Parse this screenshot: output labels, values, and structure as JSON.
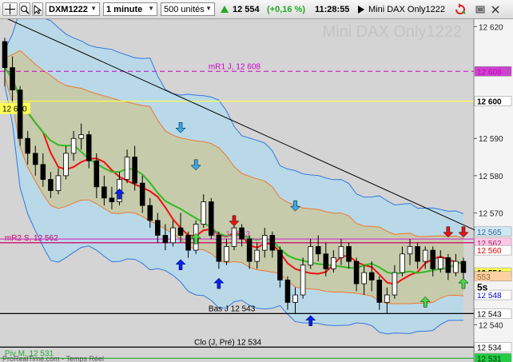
{
  "toolbar": {
    "instrument": "DXM1222",
    "timeframe": "1 minute",
    "units": "500 unités",
    "price": "12 554",
    "change": "(+0,16 %)",
    "time": "11:28:55",
    "name": "Mini DAX Only1222"
  },
  "chart": {
    "watermark": "Mini DAX Only1222",
    "countdown": "5s",
    "footer": "ProRealTime.com - Temps Réel",
    "colors": {
      "up": "#33ff66",
      "down": "#ee2211",
      "bg": "#d4d4d4",
      "accent": "#2a6ad4"
    },
    "price_axis": {
      "range": [
        12530,
        12622
      ],
      "ticks": [
        12620,
        12590,
        12580,
        12570,
        12540
      ]
    },
    "axis_labels": [
      {
        "price": 12608,
        "text": "12 608",
        "color": "#cc44cc",
        "text_color": "#cc00cc"
      },
      {
        "price": 12600,
        "text": "12 600",
        "color": "#ffffff",
        "text_color": "#000000",
        "bold": true
      },
      {
        "price": 12565,
        "text": "12 565",
        "color": "#cfe8f8",
        "text_color": "#336688"
      },
      {
        "price": 12562,
        "text": "12 562",
        "color": "#ffc8e8",
        "text_color": "#aa2266"
      },
      {
        "price": 12560,
        "text": "12 560",
        "color": "#ffffff",
        "text_color": "#dd0000"
      },
      {
        "price": 12554,
        "text": "12 554",
        "color": "#ffff55",
        "text_color": "#000000",
        "bold": true
      },
      {
        "price": 12553,
        "text": "553",
        "color": "#ffd0a0",
        "text_color": "#996633"
      },
      {
        "price": 12548,
        "text": "12 548",
        "color": "#ffffff",
        "text_color": "#0000cc"
      },
      {
        "price": 12543,
        "text": "12 543",
        "color": "#ffffff",
        "text_color": "#000000"
      },
      {
        "price": 12534,
        "text": "12 534",
        "color": "#ffffff",
        "text_color": "#000000"
      },
      {
        "price": 12531,
        "text": "12 531",
        "color": "#22cc44",
        "text_color": "#003300"
      }
    ],
    "levels": [
      {
        "price": 12608,
        "label": "mR1 J, 12 608",
        "color": "#cc00cc",
        "dash": true,
        "label_pos": 0.44
      },
      {
        "price": 12600,
        "label": "",
        "color": "#ffff44",
        "dash": false,
        "label_pos": 0
      },
      {
        "price": 12562,
        "label": "mR2 S, 12 562",
        "color": "#cc0066",
        "dash": false,
        "label_pos": 0.01
      },
      {
        "price": 12563,
        "label": "Piv...12 563",
        "color": "#cc44cc",
        "dash": false,
        "label_pos": 0.44
      },
      {
        "price": 12543,
        "label": "Bas J 12 543",
        "color": "#000000",
        "dash": false,
        "label_pos": 0.44
      },
      {
        "price": 12534,
        "label": "Clo (J, Pré) 12 534",
        "color": "#000000",
        "dash": false,
        "label_pos": 0.41
      },
      {
        "price": 12531,
        "label": "Piv M, 12 531",
        "color": "#22aa33",
        "dash": false,
        "label_pos": 0.01
      }
    ],
    "left_label": {
      "price": 12600,
      "text": "12 600"
    },
    "trendline": {
      "start": [
        0,
        12623
      ],
      "end": [
        63,
        12564
      ]
    },
    "candles": [
      [
        12616,
        12617,
        12604,
        12609
      ],
      [
        12609,
        12612,
        12600,
        12603
      ],
      [
        12603,
        12604,
        12588,
        12590
      ],
      [
        12590,
        12592,
        12583,
        12586
      ],
      [
        12586,
        12588,
        12580,
        12583
      ],
      [
        12583,
        12586,
        12577,
        12579
      ],
      [
        12579,
        12581,
        12574,
        12576
      ],
      [
        12576,
        12582,
        12575,
        12580
      ],
      [
        12580,
        12588,
        12579,
        12586
      ],
      [
        12586,
        12592,
        12584,
        12590
      ],
      [
        12590,
        12594,
        12587,
        12591
      ],
      [
        12591,
        12592,
        12582,
        12584
      ],
      [
        12584,
        12586,
        12574,
        12577
      ],
      [
        12577,
        12580,
        12572,
        12574
      ],
      [
        12574,
        12577,
        12571,
        12573
      ],
      [
        12573,
        12581,
        12572,
        12579
      ],
      [
        12579,
        12587,
        12578,
        12585
      ],
      [
        12585,
        12588,
        12576,
        12578
      ],
      [
        12578,
        12580,
        12570,
        12572
      ],
      [
        12572,
        12574,
        12566,
        12568
      ],
      [
        12568,
        12570,
        12562,
        12564
      ],
      [
        12564,
        12567,
        12560,
        12562
      ],
      [
        12562,
        12568,
        12561,
        12566
      ],
      [
        12566,
        12570,
        12562,
        12564
      ],
      [
        12564,
        12565,
        12558,
        12560
      ],
      [
        12560,
        12568,
        12559,
        12567
      ],
      [
        12567,
        12575,
        12566,
        12573
      ],
      [
        12573,
        12574,
        12563,
        12564
      ],
      [
        12564,
        12565,
        12555,
        12557
      ],
      [
        12557,
        12563,
        12556,
        12561
      ],
      [
        12561,
        12568,
        12560,
        12566
      ],
      [
        12566,
        12567,
        12561,
        12563
      ],
      [
        12563,
        12564,
        12555,
        12557
      ],
      [
        12557,
        12562,
        12555,
        12560
      ],
      [
        12560,
        12566,
        12558,
        12564
      ],
      [
        12564,
        12565,
        12558,
        12560
      ],
      [
        12560,
        12561,
        12550,
        12552
      ],
      [
        12552,
        12553,
        12544,
        12546
      ],
      [
        12546,
        12550,
        12543,
        12548
      ],
      [
        12548,
        12558,
        12547,
        12556
      ],
      [
        12556,
        12563,
        12555,
        12561
      ],
      [
        12561,
        12564,
        12557,
        12559
      ],
      [
        12559,
        12562,
        12553,
        12555
      ],
      [
        12555,
        12560,
        12554,
        12558
      ],
      [
        12558,
        12563,
        12556,
        12561
      ],
      [
        12561,
        12562,
        12555,
        12557
      ],
      [
        12557,
        12558,
        12549,
        12551
      ],
      [
        12551,
        12556,
        12548,
        12554
      ],
      [
        12554,
        12557,
        12549,
        12552
      ],
      [
        12552,
        12553,
        12544,
        12546
      ],
      [
        12546,
        12550,
        12543,
        12548
      ],
      [
        12548,
        12556,
        12547,
        12554
      ],
      [
        12554,
        12561,
        12553,
        12559
      ],
      [
        12559,
        12563,
        12556,
        12561
      ],
      [
        12561,
        12562,
        12555,
        12557
      ],
      [
        12557,
        12561,
        12555,
        12560
      ],
      [
        12560,
        12561,
        12553,
        12555
      ],
      [
        12555,
        12560,
        12554,
        12558
      ],
      [
        12558,
        12559,
        12552,
        12554
      ],
      [
        12554,
        12559,
        12553,
        12557
      ],
      [
        12557,
        12558,
        12550,
        12554
      ]
    ],
    "arrows": [
      {
        "i": 6,
        "price": 12575,
        "dir": "up",
        "color": "#0022ff"
      },
      {
        "i": 9,
        "price": 12593,
        "dir": "down",
        "color": "#33aaee"
      },
      {
        "i": 10,
        "price": 12583,
        "dir": "down",
        "color": "#33aaee"
      },
      {
        "i": 12,
        "price": 12568,
        "dir": "down",
        "color": "#ee1111"
      },
      {
        "i": 9,
        "price": 12556,
        "dir": "up",
        "color": "#0022ff"
      },
      {
        "i": 10,
        "price": 12563,
        "dir": "up",
        "color": "#44dd44"
      },
      {
        "i": 11,
        "price": 12551,
        "dir": "up",
        "color": "#0022ff"
      },
      {
        "i": 15,
        "price": 12572,
        "dir": "down",
        "color": "#33aaee"
      },
      {
        "i": 16,
        "price": 12541,
        "dir": "up",
        "color": "#0022ff"
      },
      {
        "i": 23,
        "price": 12565,
        "dir": "down",
        "color": "#ee1111"
      },
      {
        "i": 22,
        "price": 12546,
        "dir": "up",
        "color": "#44dd44"
      },
      {
        "i": 24,
        "price": 12551,
        "dir": "up",
        "color": "#44dd44"
      },
      {
        "i": 24,
        "price": 12565,
        "dir": "down",
        "color": "#ee1111"
      }
    ]
  }
}
